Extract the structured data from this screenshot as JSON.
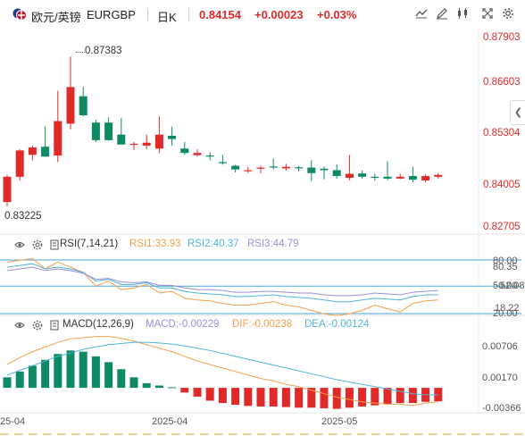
{
  "header": {
    "flag_icon": "flag-eu-gb-icon",
    "symbol_name": "欧元/英镑",
    "symbol_code": "EURGBP",
    "period": "日K",
    "price": "0.84154",
    "change": "+0.00023",
    "change_pct": "+0.03%",
    "colors": {
      "up": "#e02a2a",
      "down": "#0d8a63",
      "axis_price": "#e02a2a"
    },
    "tools": [
      "indicator-icon",
      "draw-pen-icon",
      "candle-style-icon",
      "fullscreen-icon",
      "settings-icon"
    ]
  },
  "main_chart": {
    "y_ticks": [
      "0.87903",
      "0.86603",
      "0.85304",
      "0.84005",
      "0.82705"
    ],
    "high_label": "0.87383",
    "low_label": "0.83225"
  },
  "rsi": {
    "title": "RSI(7,14,21)",
    "rsi1_label": "RSI1:33.93",
    "rsi2_label": "RSI2:40.37",
    "rsi3_label": "RSI3:44.79",
    "y_ticks": [
      "80.00",
      "80.35",
      "50.00",
      "52.08",
      "18.22",
      "20.00"
    ],
    "colors": {
      "rsi1": "#f5a04b",
      "rsi2": "#4fb5d8",
      "rsi3": "#9b8fd6",
      "band": "#4aa8d8"
    }
  },
  "macd": {
    "title": "MACD(12,26,9)",
    "macd_label": "MACD:-0.00229",
    "dif_label": "DIF:-0.00238",
    "dea_label": "DEA:-0.00124",
    "y_ticks": [
      "0.00706",
      "0.00170",
      "-0.00366"
    ],
    "colors": {
      "macd": "#9b8fd6",
      "dif": "#f5a04b",
      "dea": "#4fb5d8"
    }
  },
  "x_axis": {
    "labels": [
      "25-04",
      "2025-04",
      "2025-05"
    ]
  },
  "chart_data": {
    "type": "candlestick",
    "series": [
      {
        "name": "EURGBP",
        "candles": [
          {
            "o": 0.8341,
            "h": 0.8415,
            "l": 0.833,
            "c": 0.841
          },
          {
            "o": 0.841,
            "h": 0.8485,
            "l": 0.84,
            "c": 0.8482
          },
          {
            "o": 0.847,
            "h": 0.8495,
            "l": 0.8455,
            "c": 0.849
          },
          {
            "o": 0.8492,
            "h": 0.8548,
            "l": 0.8465,
            "c": 0.8465
          },
          {
            "o": 0.8468,
            "h": 0.8645,
            "l": 0.845,
            "c": 0.8562
          },
          {
            "o": 0.8555,
            "h": 0.8738,
            "l": 0.854,
            "c": 0.8655
          },
          {
            "o": 0.863,
            "h": 0.8655,
            "l": 0.8575,
            "c": 0.8578
          },
          {
            "o": 0.8558,
            "h": 0.8565,
            "l": 0.8505,
            "c": 0.851
          },
          {
            "o": 0.8558,
            "h": 0.8572,
            "l": 0.8508,
            "c": 0.851
          },
          {
            "o": 0.8525,
            "h": 0.857,
            "l": 0.8505,
            "c": 0.8498
          },
          {
            "o": 0.8498,
            "h": 0.8505,
            "l": 0.8483,
            "c": 0.85
          },
          {
            "o": 0.8495,
            "h": 0.8525,
            "l": 0.8485,
            "c": 0.8503
          },
          {
            "o": 0.8487,
            "h": 0.8575,
            "l": 0.8475,
            "c": 0.8525
          },
          {
            "o": 0.8522,
            "h": 0.8547,
            "l": 0.8495,
            "c": 0.8513
          },
          {
            "o": 0.8487,
            "h": 0.8505,
            "l": 0.847,
            "c": 0.8475
          },
          {
            "o": 0.8469,
            "h": 0.8485,
            "l": 0.8465,
            "c": 0.8475
          },
          {
            "o": 0.8468,
            "h": 0.8477,
            "l": 0.8455,
            "c": 0.8467
          },
          {
            "o": 0.845,
            "h": 0.847,
            "l": 0.8443,
            "c": 0.8448
          },
          {
            "o": 0.844,
            "h": 0.8442,
            "l": 0.8422,
            "c": 0.843
          },
          {
            "o": 0.8428,
            "h": 0.8437,
            "l": 0.842,
            "c": 0.8428
          },
          {
            "o": 0.8432,
            "h": 0.844,
            "l": 0.842,
            "c": 0.8435
          },
          {
            "o": 0.8438,
            "h": 0.846,
            "l": 0.843,
            "c": 0.8435
          },
          {
            "o": 0.8433,
            "h": 0.8445,
            "l": 0.8427,
            "c": 0.8437
          },
          {
            "o": 0.8436,
            "h": 0.844,
            "l": 0.8425,
            "c": 0.8435
          },
          {
            "o": 0.8435,
            "h": 0.8455,
            "l": 0.8398,
            "c": 0.842
          },
          {
            "o": 0.8432,
            "h": 0.8438,
            "l": 0.8403,
            "c": 0.8428
          },
          {
            "o": 0.8428,
            "h": 0.8444,
            "l": 0.8405,
            "c": 0.8412
          },
          {
            "o": 0.8407,
            "h": 0.847,
            "l": 0.84,
            "c": 0.8418
          },
          {
            "o": 0.8419,
            "h": 0.8427,
            "l": 0.8405,
            "c": 0.841
          },
          {
            "o": 0.841,
            "h": 0.8418,
            "l": 0.8399,
            "c": 0.8408
          },
          {
            "o": 0.841,
            "h": 0.8452,
            "l": 0.84,
            "c": 0.8405
          },
          {
            "o": 0.8405,
            "h": 0.8418,
            "l": 0.8403,
            "c": 0.841
          },
          {
            "o": 0.8412,
            "h": 0.8437,
            "l": 0.8395,
            "c": 0.8402
          },
          {
            "o": 0.84,
            "h": 0.8416,
            "l": 0.8395,
            "c": 0.8412
          },
          {
            "o": 0.841,
            "h": 0.842,
            "l": 0.8405,
            "c": 0.8415
          }
        ]
      }
    ],
    "ylim": [
      0.82705,
      0.87903
    ],
    "rsi_series": [
      {
        "name": "RSI1",
        "values": [
          78,
          80,
          82,
          70,
          78,
          72,
          66,
          50,
          56,
          46,
          48,
          52,
          42,
          44,
          36,
          34,
          33,
          30,
          28,
          28,
          30,
          32,
          28,
          26,
          22,
          18,
          16,
          18,
          22,
          28,
          24,
          20,
          30,
          33,
          34
        ]
      },
      {
        "name": "RSI2",
        "values": [
          72,
          74,
          76,
          70,
          72,
          70,
          66,
          56,
          58,
          52,
          52,
          54,
          48,
          48,
          44,
          42,
          41,
          40,
          38,
          38,
          39,
          40,
          38,
          37,
          36,
          34,
          32,
          32,
          34,
          36,
          35,
          34,
          38,
          40,
          40
        ]
      },
      {
        "name": "RSI3",
        "values": [
          68,
          70,
          72,
          68,
          70,
          68,
          65,
          58,
          59,
          55,
          54,
          55,
          51,
          51,
          48,
          46,
          46,
          45,
          43,
          43,
          44,
          44,
          43,
          42,
          42,
          40,
          39,
          39,
          40,
          42,
          41,
          40,
          43,
          44,
          45
        ]
      }
    ],
    "rsi_ylim": [
      18.22,
      80.35
    ],
    "macd_hist": [
      0.0018,
      0.0028,
      0.0038,
      0.0048,
      0.0058,
      0.0064,
      0.0062,
      0.0054,
      0.0044,
      0.0032,
      0.0018,
      0.0008,
      0.0004,
      0.0001,
      -0.0008,
      -0.0015,
      -0.0022,
      -0.0026,
      -0.0029,
      -0.0031,
      -0.0032,
      -0.0032,
      -0.0033,
      -0.0034,
      -0.0034,
      -0.0035,
      -0.0036,
      -0.0034,
      -0.0032,
      -0.003,
      -0.0028,
      -0.0026,
      -0.0026,
      -0.0024,
      -0.0023
    ],
    "dif": [
      0.004,
      0.0052,
      0.0062,
      0.007,
      0.0078,
      0.0084,
      0.0086,
      0.0088,
      0.0088,
      0.0085,
      0.008,
      0.0074,
      0.0068,
      0.0062,
      0.0054,
      0.0046,
      0.004,
      0.0034,
      0.0028,
      0.0022,
      0.0016,
      0.0012,
      0.0006,
      0.0002,
      -0.0004,
      -0.001,
      -0.0016,
      -0.002,
      -0.0024,
      -0.0026,
      -0.0028,
      -0.0028,
      -0.003,
      -0.0026,
      -0.0024
    ],
    "dea": [
      0.0022,
      0.003,
      0.0038,
      0.0046,
      0.0054,
      0.006,
      0.0066,
      0.007,
      0.0074,
      0.0076,
      0.0078,
      0.0078,
      0.0077,
      0.0075,
      0.0072,
      0.0068,
      0.0064,
      0.0059,
      0.0054,
      0.0049,
      0.0044,
      0.0039,
      0.0034,
      0.0029,
      0.0024,
      0.0019,
      0.0014,
      0.001,
      0.0006,
      0.0002,
      -0.0002,
      -0.0006,
      -0.001,
      -0.0012,
      -0.0012
    ],
    "macd_ylim": [
      -0.00366,
      0.00706
    ]
  }
}
